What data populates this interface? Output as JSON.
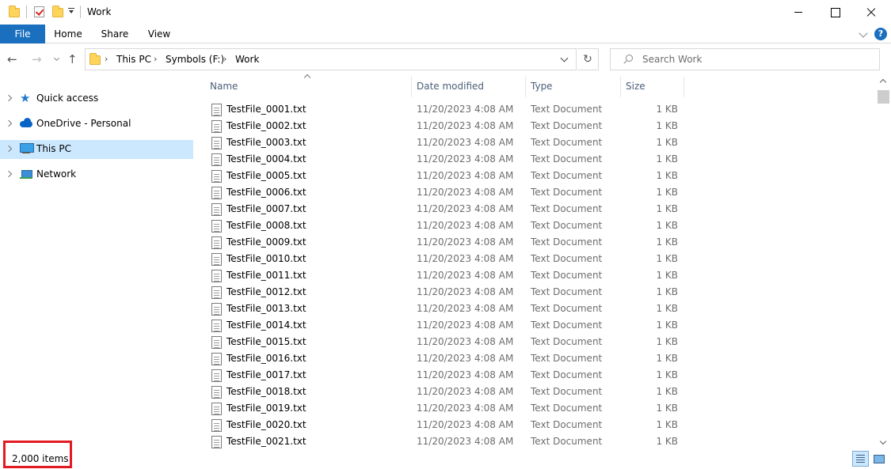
{
  "window": {
    "title": "Work"
  },
  "ribbon": {
    "tabs": [
      "File",
      "Home",
      "Share",
      "View"
    ],
    "help_label": "?"
  },
  "address": {
    "crumbs": [
      "This PC",
      "Symbols (F:)",
      "Work"
    ]
  },
  "search": {
    "placeholder": "Search Work"
  },
  "nav": {
    "items": [
      {
        "label": "Quick access",
        "icon": "star-icon"
      },
      {
        "label": "OneDrive - Personal",
        "icon": "cloud-icon"
      },
      {
        "label": "This PC",
        "icon": "computer-icon",
        "selected": true
      },
      {
        "label": "Network",
        "icon": "network-icon"
      }
    ]
  },
  "list": {
    "columns": [
      "Name",
      "Date modified",
      "Type",
      "Size"
    ],
    "sorted_by": "Name",
    "rows": [
      {
        "name": "TestFile_0001.txt",
        "date": "11/20/2023 4:08 AM",
        "type": "Text Document",
        "size": "1 KB"
      },
      {
        "name": "TestFile_0002.txt",
        "date": "11/20/2023 4:08 AM",
        "type": "Text Document",
        "size": "1 KB"
      },
      {
        "name": "TestFile_0003.txt",
        "date": "11/20/2023 4:08 AM",
        "type": "Text Document",
        "size": "1 KB"
      },
      {
        "name": "TestFile_0004.txt",
        "date": "11/20/2023 4:08 AM",
        "type": "Text Document",
        "size": "1 KB"
      },
      {
        "name": "TestFile_0005.txt",
        "date": "11/20/2023 4:08 AM",
        "type": "Text Document",
        "size": "1 KB"
      },
      {
        "name": "TestFile_0006.txt",
        "date": "11/20/2023 4:08 AM",
        "type": "Text Document",
        "size": "1 KB"
      },
      {
        "name": "TestFile_0007.txt",
        "date": "11/20/2023 4:08 AM",
        "type": "Text Document",
        "size": "1 KB"
      },
      {
        "name": "TestFile_0008.txt",
        "date": "11/20/2023 4:08 AM",
        "type": "Text Document",
        "size": "1 KB"
      },
      {
        "name": "TestFile_0009.txt",
        "date": "11/20/2023 4:08 AM",
        "type": "Text Document",
        "size": "1 KB"
      },
      {
        "name": "TestFile_0010.txt",
        "date": "11/20/2023 4:08 AM",
        "type": "Text Document",
        "size": "1 KB"
      },
      {
        "name": "TestFile_0011.txt",
        "date": "11/20/2023 4:08 AM",
        "type": "Text Document",
        "size": "1 KB"
      },
      {
        "name": "TestFile_0012.txt",
        "date": "11/20/2023 4:08 AM",
        "type": "Text Document",
        "size": "1 KB"
      },
      {
        "name": "TestFile_0013.txt",
        "date": "11/20/2023 4:08 AM",
        "type": "Text Document",
        "size": "1 KB"
      },
      {
        "name": "TestFile_0014.txt",
        "date": "11/20/2023 4:08 AM",
        "type": "Text Document",
        "size": "1 KB"
      },
      {
        "name": "TestFile_0015.txt",
        "date": "11/20/2023 4:08 AM",
        "type": "Text Document",
        "size": "1 KB"
      },
      {
        "name": "TestFile_0016.txt",
        "date": "11/20/2023 4:08 AM",
        "type": "Text Document",
        "size": "1 KB"
      },
      {
        "name": "TestFile_0017.txt",
        "date": "11/20/2023 4:08 AM",
        "type": "Text Document",
        "size": "1 KB"
      },
      {
        "name": "TestFile_0018.txt",
        "date": "11/20/2023 4:08 AM",
        "type": "Text Document",
        "size": "1 KB"
      },
      {
        "name": "TestFile_0019.txt",
        "date": "11/20/2023 4:08 AM",
        "type": "Text Document",
        "size": "1 KB"
      },
      {
        "name": "TestFile_0020.txt",
        "date": "11/20/2023 4:08 AM",
        "type": "Text Document",
        "size": "1 KB"
      },
      {
        "name": "TestFile_0021.txt",
        "date": "11/20/2023 4:08 AM",
        "type": "Text Document",
        "size": "1 KB"
      }
    ]
  },
  "status": {
    "item_count": "2,000 items"
  },
  "colors": {
    "accent": "#1a6fbf",
    "selection": "#cce8ff",
    "highlight_box": "#e41a23"
  }
}
